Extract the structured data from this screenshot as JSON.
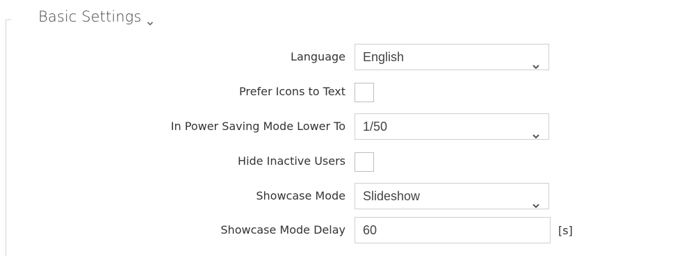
{
  "section": {
    "title": "Basic Settings"
  },
  "fields": {
    "language": {
      "label": "Language",
      "value": "English"
    },
    "prefer_icons": {
      "label": "Prefer Icons to Text",
      "checked": false
    },
    "power_saving": {
      "label": "In Power Saving Mode Lower To",
      "value": "1/50"
    },
    "hide_inactive": {
      "label": "Hide Inactive Users",
      "checked": false
    },
    "showcase_mode": {
      "label": "Showcase Mode",
      "value": "Slideshow"
    },
    "showcase_delay": {
      "label": "Showcase Mode Delay",
      "value": "60",
      "unit": "[s]"
    }
  },
  "icons": {
    "section_toggle": "chevron-down-icon",
    "select_caret": "chevron-down-icon"
  },
  "colors": {
    "border": "#cfcfcf",
    "text": "#333333",
    "frame_line": "#d4d4d4"
  }
}
